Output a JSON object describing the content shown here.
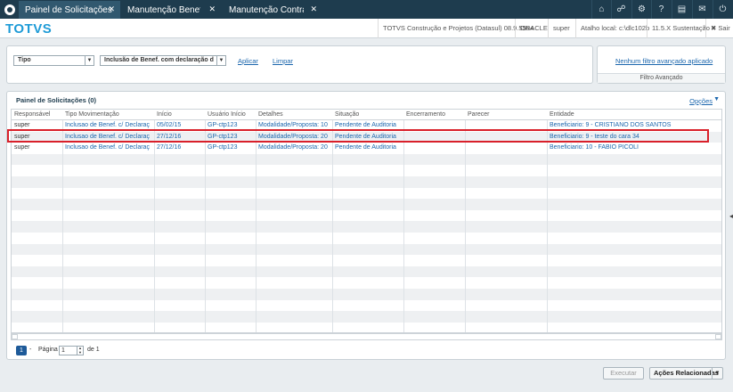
{
  "tabs": [
    {
      "label": "Painel de Solicitações",
      "active": true
    },
    {
      "label": "Manutenção Beneficiá",
      "active": false
    },
    {
      "label": "Manutenção Contratos",
      "active": false
    }
  ],
  "toolbar_icons": [
    "home-icon",
    "sitemap-icon",
    "gear-icon",
    "help-icon",
    "document-icon",
    "mail-icon",
    "power-icon"
  ],
  "header": {
    "brand": "TOTVS",
    "company": "TOTVS Construção e Projetos (Datasul) 08.9.5554",
    "db": "ORACLE",
    "user": "super",
    "shortcut": "Atalho local: c:\\dlc102b",
    "version": "11.5.X Sustentação",
    "logout": "✖ Sair"
  },
  "filter": {
    "type_select": "Tipo",
    "kind_select": "Inclusão de Benef. com declaração d",
    "apply": "Aplicar",
    "clear": "Limpar",
    "advanced_status": "Nenhum filtro avançado aplicado",
    "advanced_title": "Filtro Avançado"
  },
  "grid": {
    "title": "Painel de Solicitações (0)",
    "options": "Opções",
    "columns": [
      "Responsável",
      "Tipo Movimentação",
      "Início",
      "Usuário Início",
      "Detalhes",
      "Situação",
      "Encerramento",
      "Parecer",
      "Entidade"
    ],
    "rows": [
      [
        "super",
        "Inclusao de Benef. c/ Declaraç",
        "05/02/15",
        "GP-ctp123",
        "Modalidade/Proposta: 10",
        "Pendente de Auditoria",
        "",
        "",
        "Beneficiario: 9 - CRISTIANO DOS SANTOS"
      ],
      [
        "super",
        "Inclusao de Benef. c/ Declaraç",
        "27/12/16",
        "GP-ctp123",
        "Modalidade/Proposta: 20",
        "Pendente de Auditoria",
        "",
        "",
        "Beneficiario: 9 - teste do cara 34"
      ],
      [
        "super",
        "Inclusao de Benef. c/ Declaraç",
        "27/12/16",
        "GP-ctp123",
        "Modalidade/Proposta: 20",
        "Pendente de Auditoria",
        "",
        "",
        "Beneficiario: 10 - FABIO PICOLI"
      ]
    ],
    "selected_row_index": 1
  },
  "pager": {
    "current": "1",
    "dash": "-",
    "page_label": "Página",
    "page_value": "1",
    "of_label": "de 1"
  },
  "actions": {
    "execute": "Executar",
    "related": "Ações Relacionadas"
  }
}
